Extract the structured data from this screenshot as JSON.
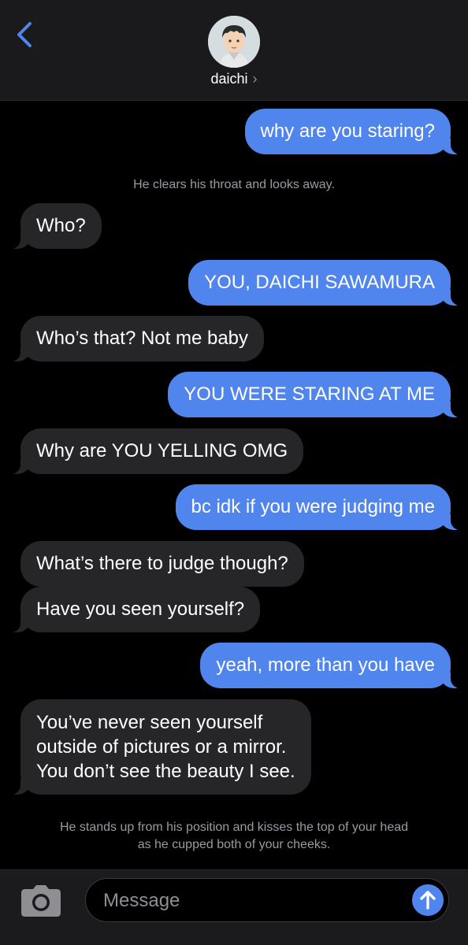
{
  "header": {
    "contact_name": "daichi",
    "chevron": "›"
  },
  "messages": [
    {
      "text": "why are you staring?"
    },
    {
      "text": "He clears his throat and looks away."
    },
    {
      "text": "Who?"
    },
    {
      "text": "YOU, DAICHI SAWAMURA"
    },
    {
      "text": "Who’s that? Not me baby"
    },
    {
      "text": "YOU WERE STARING AT ME"
    },
    {
      "text": "Why are YOU YELLING OMG"
    },
    {
      "text": "bc idk if you were judging me"
    },
    {
      "text": "What’s there to judge though?"
    },
    {
      "text": "Have you seen yourself?"
    },
    {
      "text": "yeah, more than you have"
    },
    {
      "lines": [
        "You’ve never seen yourself",
        "outside of pictures or a mirror.",
        "You don’t see the beauty I see."
      ]
    },
    {
      "lines": [
        "He stands up from his position and kisses the top of your head",
        "as he cupped both of your cheeks."
      ]
    }
  ],
  "composer": {
    "placeholder": "Message"
  },
  "colors": {
    "outgoing_bubble": "#4f85ec",
    "incoming_bubble": "#262628",
    "accent": "#4f85ec"
  },
  "icons": {
    "back": "chevron-left-icon",
    "camera": "camera-icon",
    "send": "arrow-up-icon"
  }
}
